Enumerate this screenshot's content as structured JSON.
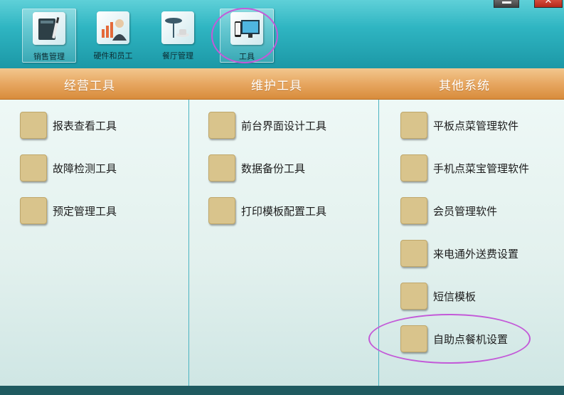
{
  "toolbar": {
    "items": [
      {
        "label": "销售管理",
        "icon": "ledger-icon"
      },
      {
        "label": "硬件和员工",
        "icon": "employee-chart-icon"
      },
      {
        "label": "餐厅管理",
        "icon": "restaurant-icon"
      },
      {
        "label": "工具",
        "icon": "devices-icon"
      }
    ],
    "selected": "销售管理",
    "window_close": "✕"
  },
  "columns": [
    {
      "title": "经营工具",
      "items": [
        "报表查看工具",
        "故障检测工具",
        "预定管理工具"
      ]
    },
    {
      "title": "维护工具",
      "items": [
        "前台界面设计工具",
        "数据备份工具",
        "打印模板配置工具"
      ]
    },
    {
      "title": "其他系统",
      "items": [
        "平板点菜管理软件",
        "手机点菜宝管理软件",
        "会员管理软件",
        "来电通外送费设置",
        "短信模板",
        "自助点餐机设置"
      ]
    }
  ],
  "colors": {
    "accent_circle": "#c35ad8",
    "header": "#e7a761",
    "tile": "#d9c48c",
    "topbar": "#2fb5c2"
  }
}
